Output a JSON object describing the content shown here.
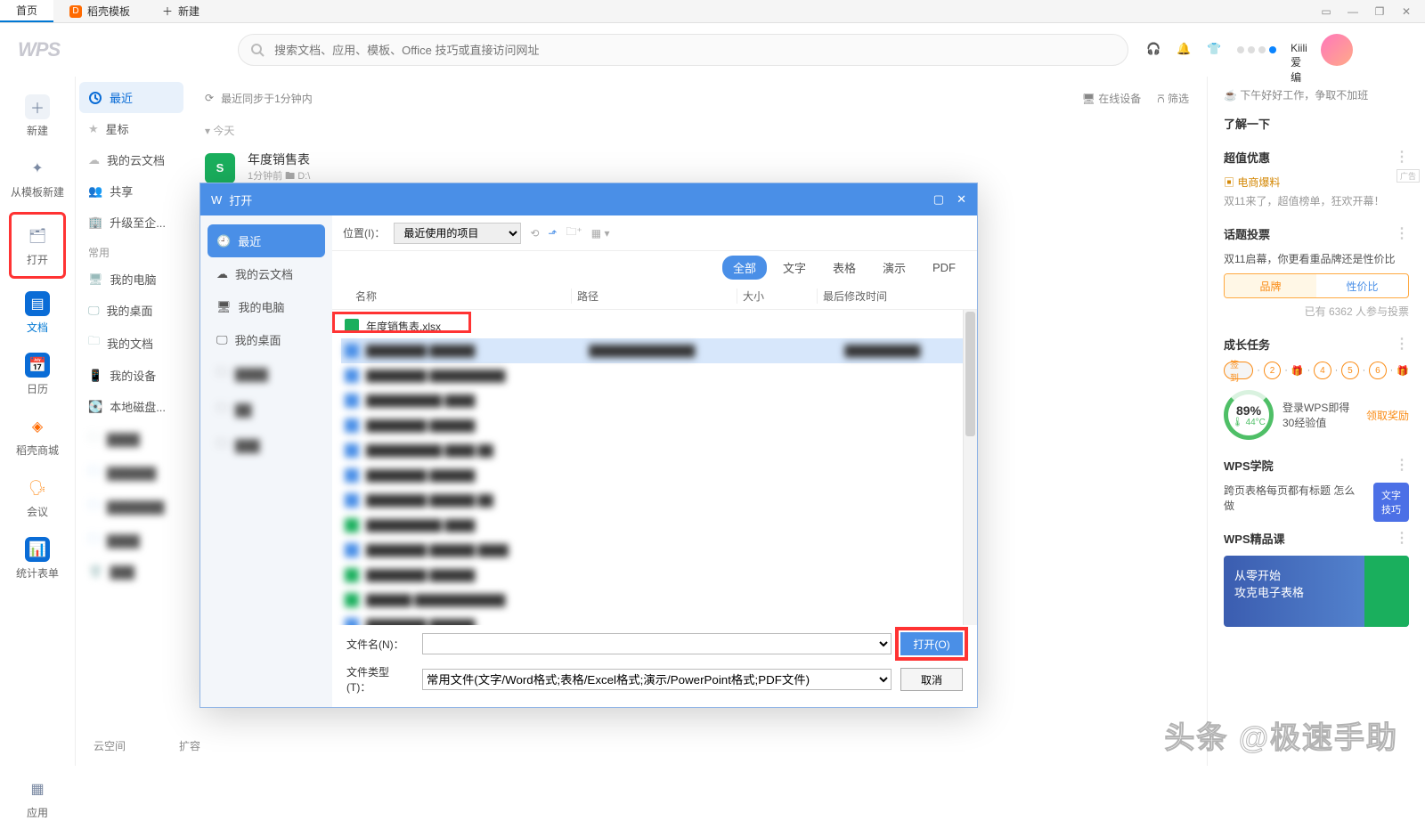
{
  "tabs": {
    "home": "首页",
    "template": "稻壳模板",
    "newTab": "新建"
  },
  "header": {
    "logo": "WPS",
    "searchPlaceholder": "搜索文档、应用、模板、Office 技巧或直接访问网址",
    "username": "Kiili爱编"
  },
  "rail": {
    "new": "新建",
    "fromTemplate": "从模板新建",
    "open": "打开",
    "docs": "文档",
    "calendar": "日历",
    "store": "稻壳商城",
    "meeting": "会议",
    "statsForm": "统计表单",
    "apps": "应用"
  },
  "filecol": {
    "recent": "最近",
    "star": "星标",
    "mycloud": "我的云文档",
    "share": "共享",
    "upgrade": "升级至企...",
    "commonLabel": "常用",
    "mypc": "我的电脑",
    "desktop": "我的桌面",
    "mydocs": "我的文档",
    "devices": "我的设备",
    "localDisk": "本地磁盘...",
    "cloudSpace": "云空间",
    "expand": "扩容"
  },
  "mid": {
    "sync": "最近同步于1分钟内",
    "devicesOnline": "在线设备",
    "filter": "筛选",
    "today": "今天",
    "file": {
      "name": "年度销售表",
      "meta": "1分钟前    🖿 D:\\"
    }
  },
  "right": {
    "slogan": "下午好好工作，争取不加班",
    "learn": "了解一下",
    "promo": {
      "title": "超值优惠",
      "line1": "电商爆料",
      "line2": "双11来了，超值榜单，狂欢开幕！"
    },
    "vote": {
      "title": "话题投票",
      "q": "双11启幕，你更看重品牌还是性价比",
      "opt1": "品牌",
      "opt2": "性价比",
      "count": "已有 6362 人参与投票"
    },
    "growth": {
      "title": "成长任务",
      "signin": "签到",
      "bonus": "登录WPS即得30经验值",
      "claim": "领取奖励",
      "ring": "89",
      "ringUnit": "%",
      "temp": "44°C"
    },
    "academy": {
      "title": "WPS学院",
      "tip": "跨页表格每页都有标题 怎么做",
      "badge": "文字技巧"
    },
    "course": {
      "title": "WPS精品课",
      "headline1": "从零开始",
      "headline2": "攻克电子表格"
    },
    "adBadge": "广告"
  },
  "dialog": {
    "title": "打开",
    "locLabel": "位置(I)：",
    "locValue": "最近使用的项目",
    "side": {
      "recent": "最近",
      "mycloud": "我的云文档",
      "mypc": "我的电脑",
      "desktop": "我的桌面"
    },
    "filters": {
      "all": "全部",
      "text": "文字",
      "sheet": "表格",
      "slides": "演示",
      "pdf": "PDF"
    },
    "cols": {
      "name": "名称",
      "path": "路径",
      "size": "大小",
      "mod": "最后修改时间"
    },
    "file0": "年度销售表.xlsx",
    "fnameLabel": "文件名(N)：",
    "ftypeLabel": "文件类型(T)：",
    "ftypeValue": "常用文件(文字/Word格式;表格/Excel格式;演示/PowerPoint格式;PDF文件)",
    "openBtn": "打开(O)",
    "cancelBtn": "取消"
  },
  "watermark": "头条 @极速手助"
}
